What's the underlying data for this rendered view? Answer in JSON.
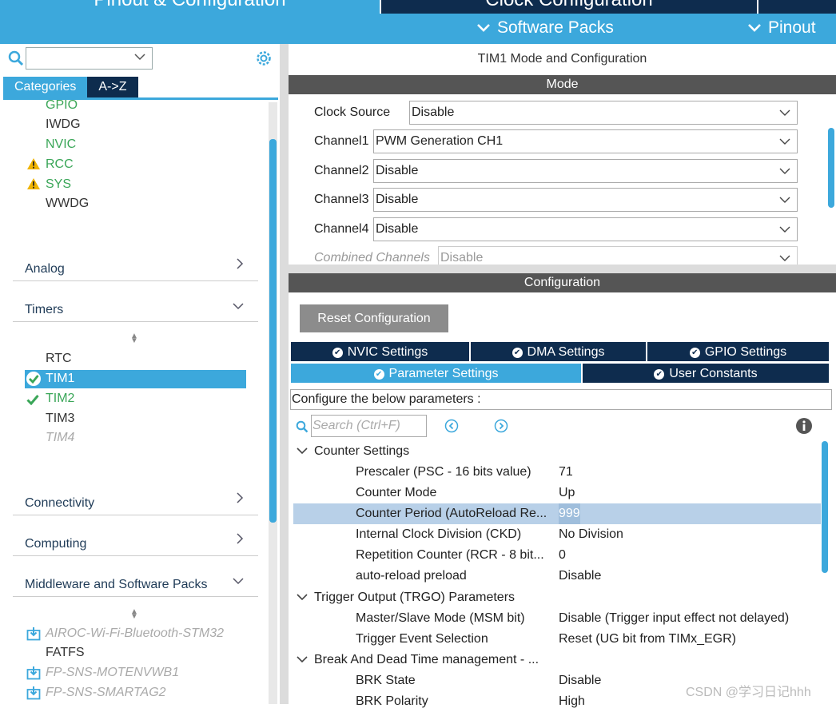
{
  "top_tabs": {
    "pinout_config": "Pinout & Configuration",
    "clock_config": "Clock Configuration"
  },
  "subbar": {
    "software_packs": "Software Packs",
    "pinout": "Pinout"
  },
  "left": {
    "category_tabs": [
      "Categories",
      "A->Z"
    ],
    "system_core_items": [
      {
        "label": "GPIO",
        "color": "#3aa658",
        "warn": false
      },
      {
        "label": "IWDG",
        "color": "#333333",
        "warn": false
      },
      {
        "label": "NVIC",
        "color": "#3aa658",
        "warn": false
      },
      {
        "label": "RCC",
        "color": "#3aa658",
        "warn": true
      },
      {
        "label": "SYS",
        "color": "#3aa658",
        "warn": true
      },
      {
        "label": "WWDG",
        "color": "#333333",
        "warn": false
      }
    ],
    "sections": {
      "analog": "Analog",
      "timers": "Timers",
      "connectivity": "Connectivity",
      "computing": "Computing",
      "middleware": "Middleware and Software Packs"
    },
    "timer_items": [
      {
        "label": "RTC",
        "state": "none"
      },
      {
        "label": "TIM1",
        "state": "selected"
      },
      {
        "label": "TIM2",
        "state": "check"
      },
      {
        "label": "TIM3",
        "state": "none"
      },
      {
        "label": "TIM4",
        "state": "disabled"
      }
    ],
    "middleware_items": [
      {
        "label": "AIROC-Wi-Fi-Bluetooth-STM32",
        "state": "pack"
      },
      {
        "label": "FATFS",
        "state": "none"
      },
      {
        "label": "FP-SNS-MOTENVWB1",
        "state": "pack"
      },
      {
        "label": "FP-SNS-SMARTAG2",
        "state": "pack"
      }
    ]
  },
  "right": {
    "title": "TIM1 Mode and Configuration",
    "mode_band": "Mode",
    "mode_rows": [
      {
        "label": "Clock Source",
        "value": "Disable"
      },
      {
        "label": "Channel1",
        "value": "PWM Generation CH1"
      },
      {
        "label": "Channel2",
        "value": "Disable"
      },
      {
        "label": "Channel3",
        "value": "Disable"
      },
      {
        "label": "Channel4",
        "value": "Disable"
      },
      {
        "label": "Combined Channels",
        "value": "Disable"
      }
    ],
    "config_band": "Configuration",
    "reset_button": "Reset Configuration",
    "tabs_row1": [
      "NVIC Settings",
      "DMA Settings",
      "GPIO Settings"
    ],
    "tabs_row2": [
      "Parameter Settings",
      "User Constants"
    ],
    "configure_text": "Configure the below parameters :",
    "search_placeholder": "Search (Ctrl+F)",
    "groups": {
      "counter": "Counter Settings",
      "trgo": "Trigger Output (TRGO) Parameters",
      "brk": "Break And Dead Time management - ..."
    },
    "counter_params": [
      {
        "k": "Prescaler (PSC - 16 bits value)",
        "v": "71"
      },
      {
        "k": "Counter Mode",
        "v": "Up"
      },
      {
        "k": "Counter Period (AutoReload Re...",
        "v": "999"
      },
      {
        "k": "Internal Clock Division (CKD)",
        "v": "No Division"
      },
      {
        "k": "Repetition Counter (RCR - 8 bit...",
        "v": "0"
      },
      {
        "k": "auto-reload preload",
        "v": "Disable"
      }
    ],
    "trgo_params": [
      {
        "k": "Master/Slave Mode (MSM bit)",
        "v": "Disable (Trigger input effect not delayed)"
      },
      {
        "k": "Trigger Event Selection",
        "v": "Reset (UG bit from TIMx_EGR)"
      }
    ],
    "brk_params": [
      {
        "k": "BRK State",
        "v": "Disable"
      },
      {
        "k": "BRK Polarity",
        "v": "High"
      }
    ]
  },
  "watermark": "CSDN @学习日记hhh",
  "colors": {
    "accent": "#3ca8dc",
    "navy": "#0e2c4e",
    "green": "#3aa658",
    "warn": "#f0b400",
    "highlight": "#b8d0e8"
  }
}
